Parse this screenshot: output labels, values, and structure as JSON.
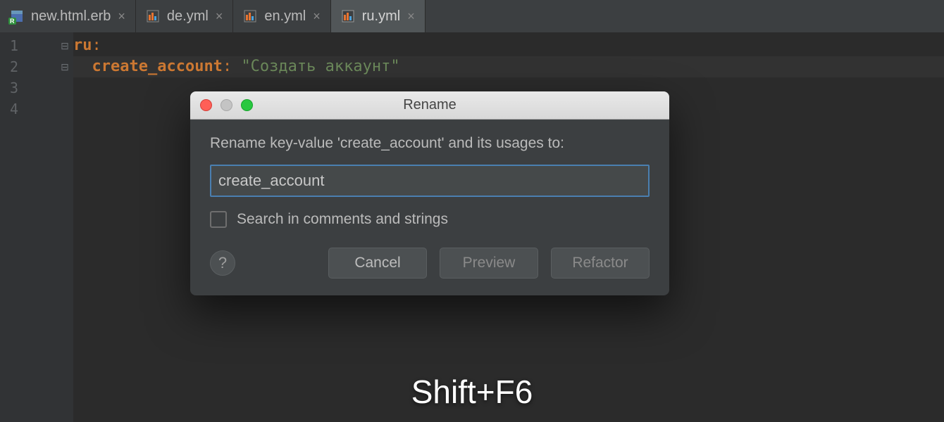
{
  "tabs": [
    {
      "label": "new.html.erb",
      "active": false,
      "type": "erb"
    },
    {
      "label": "de.yml",
      "active": false,
      "type": "yml"
    },
    {
      "label": "en.yml",
      "active": false,
      "type": "yml"
    },
    {
      "label": "ru.yml",
      "active": true,
      "type": "yml"
    }
  ],
  "gutter": {
    "lines": [
      "1",
      "2",
      "3",
      "4"
    ]
  },
  "code": {
    "line1_key": "ru",
    "line1_colon": ":",
    "line2_indent": "  ",
    "line2_key": "create_account",
    "line2_colon": ":",
    "line2_sep": " ",
    "line2_value": "\"Создать аккаунт\""
  },
  "dialog": {
    "title": "Rename",
    "message": "Rename key-value 'create_account' and its usages to:",
    "input_value": "create_account",
    "checkbox_label": "Search in comments and strings",
    "help": "?",
    "buttons": {
      "cancel": "Cancel",
      "preview": "Preview",
      "refactor": "Refactor"
    }
  },
  "shortcut": "Shift+F6"
}
